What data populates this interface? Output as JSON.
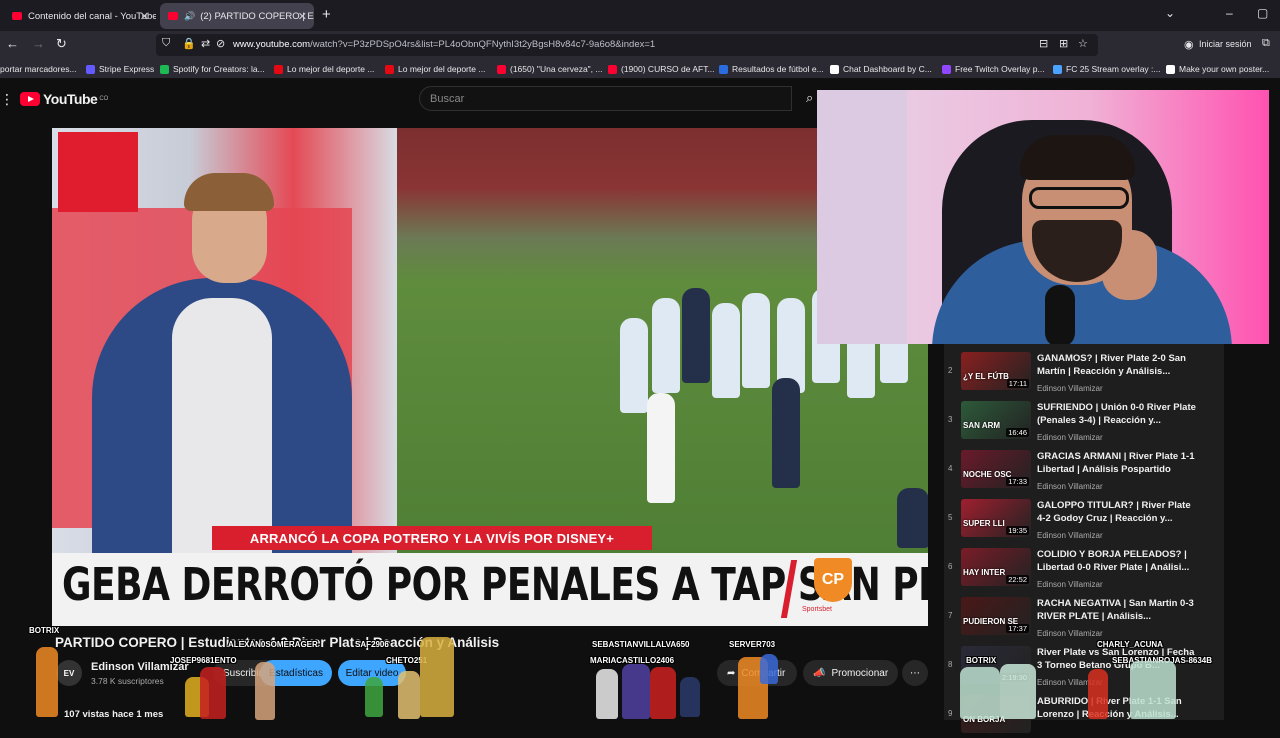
{
  "browser": {
    "tabs": [
      {
        "label": "Contenido del canal - YouTube",
        "active": false
      },
      {
        "label": "(2) PARTIDO COPERO | Estu",
        "active": true
      }
    ],
    "new_tab_icon": "plus-icon",
    "url_prefix": "www.youtube.com",
    "url_rest": "/watch?v=P3zPDSpO4rs&list=PL4oObnQFNythI3t2yBgsH8v84c7-9a6o8&index=1",
    "sign_in": "Iniciar sesión",
    "bookmarks": [
      {
        "label": "portar marcadores...",
        "color": "#2b2a33"
      },
      {
        "label": "Stripe Express",
        "color": "#635bff"
      },
      {
        "label": "Spotify for Creators: la...",
        "color": "#1db954"
      },
      {
        "label": "Lo mejor del deporte ...",
        "color": "#e50914"
      },
      {
        "label": "Lo mejor del deporte ...",
        "color": "#e50914"
      },
      {
        "label": "(1650) \"Una cerveza\", ...",
        "color": "#ff0033"
      },
      {
        "label": "(1900) CURSO de AFT...",
        "color": "#ff0033"
      },
      {
        "label": "Resultados de fútbol e...",
        "color": "#2a6de1"
      },
      {
        "label": "Chat Dashboard by C...",
        "color": "#ffffff"
      },
      {
        "label": "Free Twitch Overlay p...",
        "color": "#9146ff"
      },
      {
        "label": "FC 25 Stream overlay :...",
        "color": "#4aa3ff"
      },
      {
        "label": "Make your own poster...",
        "color": "#ffffff"
      }
    ]
  },
  "youtube": {
    "logo_text": "YouTube",
    "logo_country": "CO",
    "search_placeholder": "Buscar",
    "video": {
      "banner_red": "ARRANCÓ LA COPA POTRERO Y LA VIVÍS POR DISNEY+",
      "headline": "GEBA DERROTÓ POR PENALES A TAP SAN PEDRO",
      "cp_logo": "CP",
      "cp_sub": "Sportsbet"
    },
    "title": "PARTIDO COPERO | Estudiantes 4-2 River Plate | Reacción y Análisis",
    "channel": {
      "avatar_text": "EV",
      "name": "Edinson Villamizar",
      "subscribers": "3.78 K suscriptores"
    },
    "actions": {
      "subscribe": "Suscribirse",
      "stats": "Estadísticas",
      "edit": "Editar video",
      "share": "Compartir",
      "promote": "Promocionar",
      "more": "⋯"
    },
    "meta": "107 vistas  hace 1 mes",
    "playlist": [
      {
        "num": "2",
        "thumb_label": "¿Y EL FÚTB",
        "duration": "17:11",
        "title": "GANAMOS? | River Plate 2-0 San Martín | Reacción y Análisis...",
        "channel": "Edinson Villamizar",
        "color": "#8a1f1f"
      },
      {
        "num": "3",
        "thumb_label": "SAN ARM",
        "duration": "16:46",
        "title": "SUFRIENDO | Unión 0-0 River Plate (Penales 3-4) | Reacción y...",
        "channel": "Edinson Villamizar",
        "color": "#2d5a3a"
      },
      {
        "num": "4",
        "thumb_label": "NOCHE OSC",
        "duration": "17:33",
        "title": "GRACIAS ARMANI | River Plate 1-1 Libertad | Análisis Pospartido",
        "channel": "Edinson Villamizar",
        "color": "#6a1a2a"
      },
      {
        "num": "5",
        "thumb_label": "SUPER LLI",
        "duration": "19:35",
        "title": "GALOPPO TITULAR? | River Plate 4-2 Godoy Cruz | Reacción y...",
        "channel": "Edinson Villamizar",
        "color": "#a01f2f"
      },
      {
        "num": "6",
        "thumb_label": "HAY INTER",
        "duration": "22:52",
        "title": "COLIDIO Y BORJA PELEADOS? | Libertad 0-0 River Plate | Análisi...",
        "channel": "Edinson Villamizar",
        "color": "#7a1c28"
      },
      {
        "num": "7",
        "thumb_label": "PUDIERON SE",
        "duration": "17:37",
        "title": "RACHA NEGATIVA | San Martin 0-3 RIVER PLATE | Análisis...",
        "channel": "Edinson Villamizar",
        "color": "#4a1818"
      },
      {
        "num": "8",
        "thumb_label": "",
        "duration": "2:19:30",
        "title": "River Plate vs San Lorenzo | Fecha 3 Torneo Betano Grupo B...",
        "channel": "Edinson Villamizar",
        "color": "#2a2a38"
      },
      {
        "num": "9",
        "thumb_label": "ON BORJA",
        "duration": "",
        "title": "ABURRIDO | River Plate 1-1 San Lorenzo | Reacción y Análisis...",
        "channel": "",
        "color": "#3a1a1a"
      }
    ]
  },
  "overlay_names": [
    "BOTRIX",
    "JOSEP9681ENTO",
    "ALEXAN0SOMERAGER",
    "SAF2906",
    "CHETO251",
    "SEBASTIANVILLALVA650",
    "MARIACASTILLO2406",
    "SERVER703",
    "CHARLY_ACUNA",
    "SEBASTIANROJAS-8634B",
    "BOTRIX"
  ]
}
